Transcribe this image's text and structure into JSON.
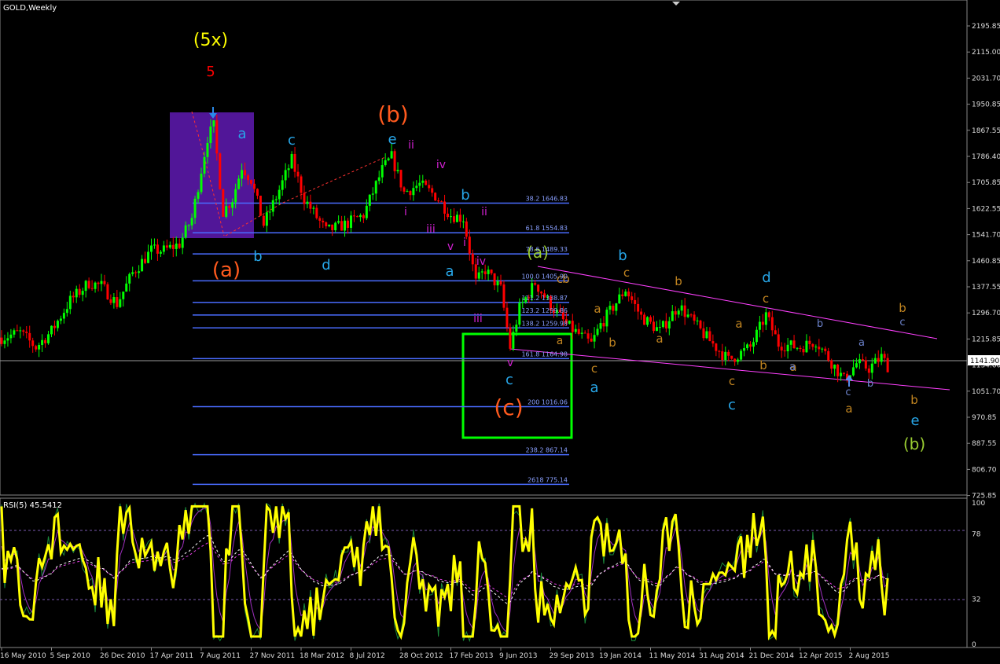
{
  "chart_data": [
    {
      "type": "candlestick",
      "title": "GOLD,Weekly",
      "last_price": "1141.90",
      "price_axis_labels": [
        "2195.85",
        "2115.00",
        "2031.70",
        "1950.85",
        "1867.55",
        "1786.40",
        "1705.85",
        "1622.55",
        "1541.70",
        "1460.85",
        "1377.55",
        "1296.70",
        "1215.85",
        "1134.60",
        "1051.70",
        "970.85",
        "887.55",
        "806.70",
        "725.85"
      ],
      "date_axis_labels": [
        "16 May 2010",
        "5 Sep 2010",
        "26 Dec 2010",
        "17 Apr 2011",
        "7 Aug 2011",
        "27 Nov 2011",
        "18 Mar 2012",
        "8 Jul 2012",
        "28 Oct 2012",
        "17 Feb 2013",
        "9 Jun 2013",
        "29 Sep 2013",
        "19 Jan 2014",
        "11 May 2014",
        "31 Aug 2014",
        "21 Dec 2014",
        "12 Apr 2015",
        "2 Aug 2015"
      ],
      "price_path": [
        [
          "2010-05-16",
          1230
        ],
        [
          "2010-06-27",
          1245
        ],
        [
          "2010-08-01",
          1200
        ],
        [
          "2010-09-05",
          1250
        ],
        [
          "2010-10-17",
          1345
        ],
        [
          "2010-11-28",
          1400
        ],
        [
          "2010-12-26",
          1390
        ],
        [
          "2011-01-30",
          1335
        ],
        [
          "2011-03-06",
          1430
        ],
        [
          "2011-04-17",
          1500
        ],
        [
          "2011-05-15",
          1500
        ],
        [
          "2011-06-19",
          1520
        ],
        [
          "2011-07-17",
          1600
        ],
        [
          "2011-08-21",
          1850
        ],
        [
          "2011-09-04",
          1885
        ],
        [
          "2011-09-25",
          1620
        ],
        [
          "2011-10-16",
          1660
        ],
        [
          "2011-11-06",
          1760
        ],
        [
          "2011-11-27",
          1720
        ],
        [
          "2011-12-25",
          1580
        ],
        [
          "2012-01-22",
          1665
        ],
        [
          "2012-02-26",
          1780
        ],
        [
          "2012-03-25",
          1660
        ],
        [
          "2012-05-13",
          1560
        ],
        [
          "2012-06-24",
          1580
        ],
        [
          "2012-08-05",
          1610
        ],
        [
          "2012-09-16",
          1750
        ],
        [
          "2012-10-07",
          1790
        ],
        [
          "2012-11-04",
          1680
        ],
        [
          "2012-12-09",
          1705
        ],
        [
          "2013-01-13",
          1670
        ],
        [
          "2013-02-17",
          1610
        ],
        [
          "2013-03-17",
          1600
        ],
        [
          "2013-04-14",
          1400
        ],
        [
          "2013-05-05",
          1440
        ],
        [
          "2013-06-09",
          1380
        ],
        [
          "2013-06-30",
          1200
        ],
        [
          "2013-07-21",
          1320
        ],
        [
          "2013-08-25",
          1400
        ],
        [
          "2013-09-29",
          1330
        ],
        [
          "2013-11-03",
          1270
        ],
        [
          "2013-12-29",
          1210
        ],
        [
          "2014-01-19",
          1270
        ],
        [
          "2014-03-16",
          1380
        ],
        [
          "2014-04-20",
          1295
        ],
        [
          "2014-06-01",
          1250
        ],
        [
          "2014-07-13",
          1330
        ],
        [
          "2014-09-14",
          1230
        ],
        [
          "2014-11-02",
          1160
        ],
        [
          "2014-12-21",
          1200
        ],
        [
          "2015-01-25",
          1300
        ],
        [
          "2015-02-22",
          1210
        ],
        [
          "2015-04-12",
          1200
        ],
        [
          "2015-05-17",
          1220
        ],
        [
          "2015-07-19",
          1100
        ],
        [
          "2015-08-16",
          1150
        ],
        [
          "2015-09-13",
          1135
        ],
        [
          "2015-10-11",
          1170
        ],
        [
          "2015-10-25",
          1141.9
        ]
      ]
    },
    {
      "type": "line",
      "title": "RSI(5) 45.5412",
      "y_axis_labels": [
        "100",
        "78",
        "32",
        "0"
      ],
      "levels": [
        78,
        32
      ],
      "grid": false
    }
  ],
  "fib_levels": [
    {
      "label": "38.2  1646.83"
    },
    {
      "label": "61.8  1554.83"
    },
    {
      "label": "78.6  1489.33"
    },
    {
      "label": "100.0  1405.90"
    },
    {
      "label": "111.2  1338.87"
    },
    {
      "label": "123.2  1299.86"
    },
    {
      "label": "138.2  1259.98"
    },
    {
      "label": "161.8  1164.98"
    },
    {
      "label": "200  1016.06"
    },
    {
      "label": "238.2  867.14"
    },
    {
      "label": "2618  775.14"
    }
  ],
  "wave_labels": [
    {
      "text": "(5x)",
      "color": "#ffff00"
    },
    {
      "text": "5",
      "color": "#ff0000"
    },
    {
      "text": "(b)",
      "color": "#ff5a1e"
    },
    {
      "text": "(a)",
      "color": "#ff5a1e"
    },
    {
      "text": "(c)",
      "color": "#ff5a1e"
    },
    {
      "text": "(a)",
      "color": "#9acd32"
    },
    {
      "text": "(b)",
      "color": "#9acd32"
    },
    {
      "text": "a",
      "color": "#27a6e8"
    },
    {
      "text": "c",
      "color": "#27a6e8"
    },
    {
      "text": "b",
      "color": "#27a6e8"
    },
    {
      "text": "d",
      "color": "#27a6e8"
    },
    {
      "text": "e",
      "color": "#27a6e8"
    },
    {
      "text": "b",
      "color": "#27a6e8"
    },
    {
      "text": "a",
      "color": "#27a6e8"
    },
    {
      "text": "c",
      "color": "#27a6e8"
    },
    {
      "text": "a",
      "color": "#27a6e8"
    },
    {
      "text": "b",
      "color": "#27a6e8"
    },
    {
      "text": "d",
      "color": "#27a6e8"
    },
    {
      "text": "c",
      "color": "#27a6e8"
    },
    {
      "text": "e",
      "color": "#27a6e8"
    },
    {
      "text": "ii",
      "color": "#d020d0"
    },
    {
      "text": "iv",
      "color": "#d020d0"
    },
    {
      "text": "i",
      "color": "#d020d0"
    },
    {
      "text": "ii",
      "color": "#d020d0"
    },
    {
      "text": "iii",
      "color": "#d020d0"
    },
    {
      "text": "v",
      "color": "#d020d0"
    },
    {
      "text": "i",
      "color": "#d020d0"
    },
    {
      "text": "iv",
      "color": "#d020d0"
    },
    {
      "text": "iii",
      "color": "#d020d0"
    },
    {
      "text": "v",
      "color": "#d020d0"
    },
    {
      "text": "b",
      "color": "#c08420"
    },
    {
      "text": "c",
      "color": "#c08420"
    },
    {
      "text": "a",
      "color": "#c08420"
    },
    {
      "text": "b",
      "color": "#c08420"
    },
    {
      "text": "a",
      "color": "#c08420"
    },
    {
      "text": "b",
      "color": "#c08420"
    },
    {
      "text": "a",
      "color": "#c08420"
    },
    {
      "text": "c",
      "color": "#c08420"
    },
    {
      "text": "a",
      "color": "#c08420"
    },
    {
      "text": "b",
      "color": "#c08420"
    },
    {
      "text": "c",
      "color": "#c08420"
    },
    {
      "text": "a",
      "color": "#c08420"
    },
    {
      "text": "b",
      "color": "#c08420"
    },
    {
      "text": "a",
      "color": "#c08420"
    },
    {
      "text": "c",
      "color": "#c08420"
    },
    {
      "text": "b",
      "color": "#c08420"
    },
    {
      "text": "c",
      "color": "#c08420"
    },
    {
      "text": "b",
      "color": "#6a80c8"
    },
    {
      "text": "a",
      "color": "#6a80c8"
    },
    {
      "text": "a",
      "color": "#6a80c8"
    },
    {
      "text": "b",
      "color": "#6a80c8"
    },
    {
      "text": "c",
      "color": "#6a80c8"
    },
    {
      "text": "c",
      "color": "#6a80c8"
    }
  ],
  "colors": {
    "background": "#000000",
    "bull": "#00ff00",
    "bear": "#ff0000",
    "fib": "#4a6cff",
    "channel": "#ff40ff",
    "rsi": "#ffff00",
    "box_purple": "#6a20b8",
    "box_green": "#00ff00"
  }
}
